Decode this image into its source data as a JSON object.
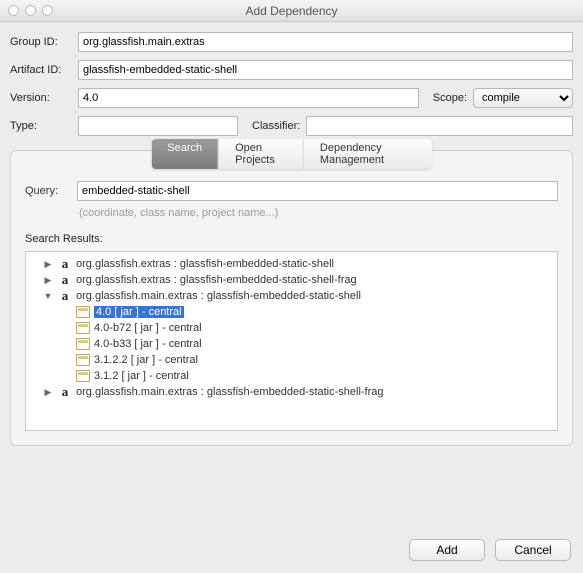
{
  "window": {
    "title": "Add Dependency"
  },
  "form": {
    "groupId": {
      "label": "Group ID:",
      "value": "org.glassfish.main.extras"
    },
    "artifactId": {
      "label": "Artifact ID:",
      "value": "glassfish-embedded-static-shell"
    },
    "version": {
      "label": "Version:",
      "value": "4.0"
    },
    "scope": {
      "label": "Scope:",
      "value": "compile"
    },
    "type": {
      "label": "Type:",
      "value": ""
    },
    "classifier": {
      "label": "Classifier:",
      "value": ""
    }
  },
  "tabs": {
    "search": "Search",
    "openProjects": "Open Projects",
    "depMgmt": "Dependency Management"
  },
  "search": {
    "queryLabel": "Query:",
    "queryValue": "embedded-static-shell",
    "hint": "(coordinate, class name, project name...)",
    "resultsLabel": "Search Results:",
    "results": [
      {
        "kind": "artifact",
        "expanded": false,
        "depth": 0,
        "text": "org.glassfish.extras : glassfish-embedded-static-shell"
      },
      {
        "kind": "artifact",
        "expanded": false,
        "depth": 0,
        "text": "org.glassfish.extras : glassfish-embedded-static-shell-frag"
      },
      {
        "kind": "artifact",
        "expanded": true,
        "depth": 0,
        "text": "org.glassfish.main.extras : glassfish-embedded-static-shell"
      },
      {
        "kind": "version",
        "depth": 1,
        "text": "4.0 [ jar ]  - central",
        "selected": true
      },
      {
        "kind": "version",
        "depth": 1,
        "text": "4.0-b72 [ jar ]  - central"
      },
      {
        "kind": "version",
        "depth": 1,
        "text": "4.0-b33 [ jar ]  - central"
      },
      {
        "kind": "version",
        "depth": 1,
        "text": "3.1.2.2 [ jar ]  - central"
      },
      {
        "kind": "version",
        "depth": 1,
        "text": "3.1.2 [ jar ]  - central"
      },
      {
        "kind": "artifact",
        "expanded": false,
        "depth": 0,
        "text": "org.glassfish.main.extras : glassfish-embedded-static-shell-frag"
      }
    ]
  },
  "buttons": {
    "add": "Add",
    "cancel": "Cancel"
  }
}
